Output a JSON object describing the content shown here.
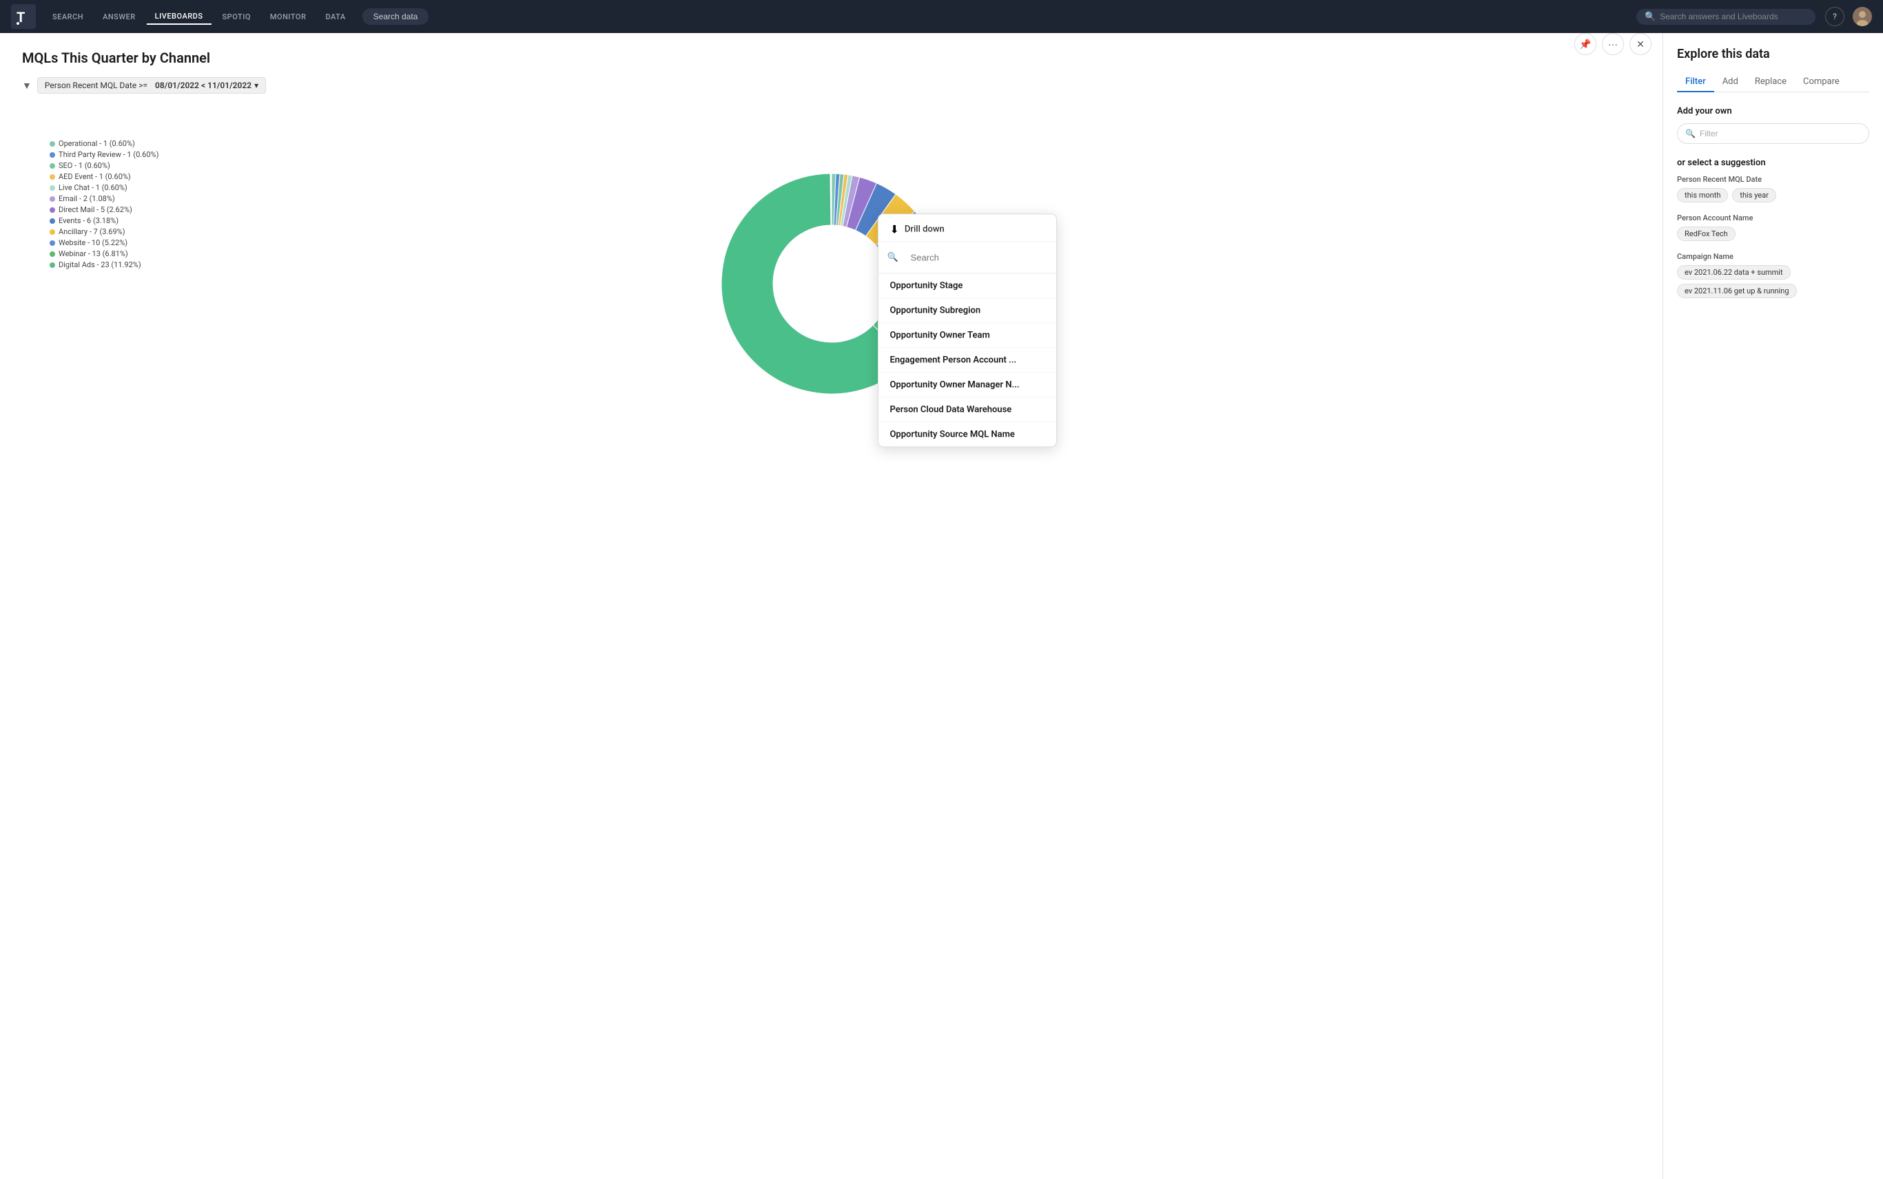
{
  "nav": {
    "search": "SEARCH",
    "answer": "ANSWER",
    "liveboards": "LIVEBOARDS",
    "spotiq": "SPOTIQ",
    "monitor": "MONITOR",
    "data": "DATA",
    "search_data_btn": "Search data",
    "search_placeholder": "Search answers and Liveboards"
  },
  "chart": {
    "title": "MQLs This Quarter by Channel",
    "filter_label": "Person Recent MQL Date >=",
    "filter_value": "08/01/2022 < 11/01/2022",
    "legend": [
      {
        "label": "Operational - 1 (0.60%)",
        "color": "#81c9b0"
      },
      {
        "label": "Third Party Review - 1 (0.60%)",
        "color": "#5b8dd9"
      },
      {
        "label": "SEO - 1 (0.60%)",
        "color": "#78c6a3"
      },
      {
        "label": "AED Event - 1 (0.60%)",
        "color": "#f0c060"
      },
      {
        "label": "Live Chat - 1 (0.60%)",
        "color": "#aaddd0"
      },
      {
        "label": "Email - 2 (1.08%)",
        "color": "#b39ddb"
      },
      {
        "label": "Direct Mail - 5 (2.62%)",
        "color": "#9575cd"
      },
      {
        "label": "Events - 6 (3.18%)",
        "color": "#4e7fc4"
      },
      {
        "label": "Ancillary - 7 (3.69%)",
        "color": "#f0c040"
      },
      {
        "label": "Website - 10 (5.22%)",
        "color": "#5c8dd4"
      },
      {
        "label": "Webinar - 13 (6.81%)",
        "color": "#60b870"
      },
      {
        "label": "Digital Ads - 23 (11.92%)",
        "color": "#5bbd82"
      }
    ]
  },
  "drill_down": {
    "title": "Drill down",
    "search_placeholder": "Search",
    "items": [
      "Opportunity Stage",
      "Opportunity Subregion",
      "Opportunity Owner Team",
      "Engagement Person Account ...",
      "Opportunity Owner Manager N...",
      "Person Cloud Data Warehouse",
      "Opportunity Source MQL Name"
    ]
  },
  "panel": {
    "title": "Explore this data",
    "tabs": [
      "Filter",
      "Add",
      "Replace",
      "Compare"
    ],
    "active_tab": "Filter",
    "section_title": "Add your own",
    "filter_placeholder": "Filter",
    "suggestion_title": "or select a suggestion",
    "suggestions": [
      {
        "label": "Person Recent MQL Date",
        "chips": [
          "this month",
          "this year"
        ]
      },
      {
        "label": "Person Account Name",
        "chips": [
          "RedFox Tech"
        ]
      },
      {
        "label": "Campaign Name",
        "chips": [
          "ev 2021.06.22 data + summit",
          "ev 2021.11.06 get up & running"
        ]
      }
    ]
  },
  "colors": {
    "accent": "#1a6dcc",
    "nav_bg": "#1e2532"
  }
}
